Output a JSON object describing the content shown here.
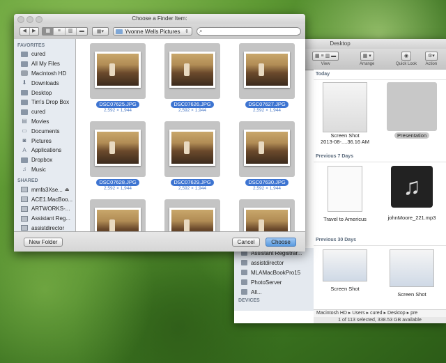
{
  "finder": {
    "title": "Desktop",
    "toolbar": {
      "view_label": "View",
      "arrange_label": "Arrange",
      "quicklook_label": "Quick Look",
      "action_label": "Action"
    },
    "sidebar": [
      "Assistant Registrar...",
      "assistdirector",
      "MLAMacBookPro15",
      "PhotoServer",
      "All..."
    ],
    "devices_header": "DEVICES",
    "sections": [
      "Today",
      "Previous 7 Days",
      "Previous 30 Days"
    ],
    "items": [
      {
        "line1": "Screen Shot",
        "line2": "2013-08-....36.16 AM"
      },
      {
        "line1": "Presentation",
        "line2": ""
      },
      {
        "line1": "Travel to Americus",
        "line2": ""
      },
      {
        "line1": "johnMoore_221.mp3",
        "line2": ""
      },
      {
        "line1": "Screen Shot",
        "line2": ""
      },
      {
        "line1": "Screen Shot",
        "line2": ""
      }
    ],
    "path": [
      "Macintosh HD",
      "Users",
      "cured",
      "Desktop",
      "pre"
    ],
    "status": "1 of 113 selected, 338.53 GB available"
  },
  "dialog": {
    "title": "Choose a Finder Item:",
    "location": "Yvonne Wells Pictures",
    "search_placeholder": "",
    "sidebar": {
      "favorites_header": "FAVORITES",
      "favorites": [
        "cured",
        "All My Files",
        "Macintosh HD",
        "Downloads",
        "Desktop",
        "Tim's Drop Box",
        "cured",
        "Movies",
        "Documents",
        "Pictures",
        "Applications",
        "Dropbox",
        "Music"
      ],
      "shared_header": "SHARED",
      "shared": [
        "mmfa3Xse...",
        "ACE1.MacBoo...",
        "ARTWORKS-...",
        "Assistant Reg...",
        "assistdirector"
      ]
    },
    "files": [
      {
        "name": "DSC07625.JPG",
        "dims": "2,592 × 1,944"
      },
      {
        "name": "DSC07626.JPG",
        "dims": "2,592 × 1,944"
      },
      {
        "name": "DSC07627.JPG",
        "dims": "2,592 × 1,944"
      },
      {
        "name": "DSC07628.JPG",
        "dims": "2,592 × 1,944"
      },
      {
        "name": "DSC07629.JPG",
        "dims": "2,592 × 1,944"
      },
      {
        "name": "DSC07630.JPG",
        "dims": "2,592 × 1,944"
      }
    ],
    "new_folder_label": "New Folder",
    "cancel_label": "Cancel",
    "choose_label": "Choose"
  }
}
